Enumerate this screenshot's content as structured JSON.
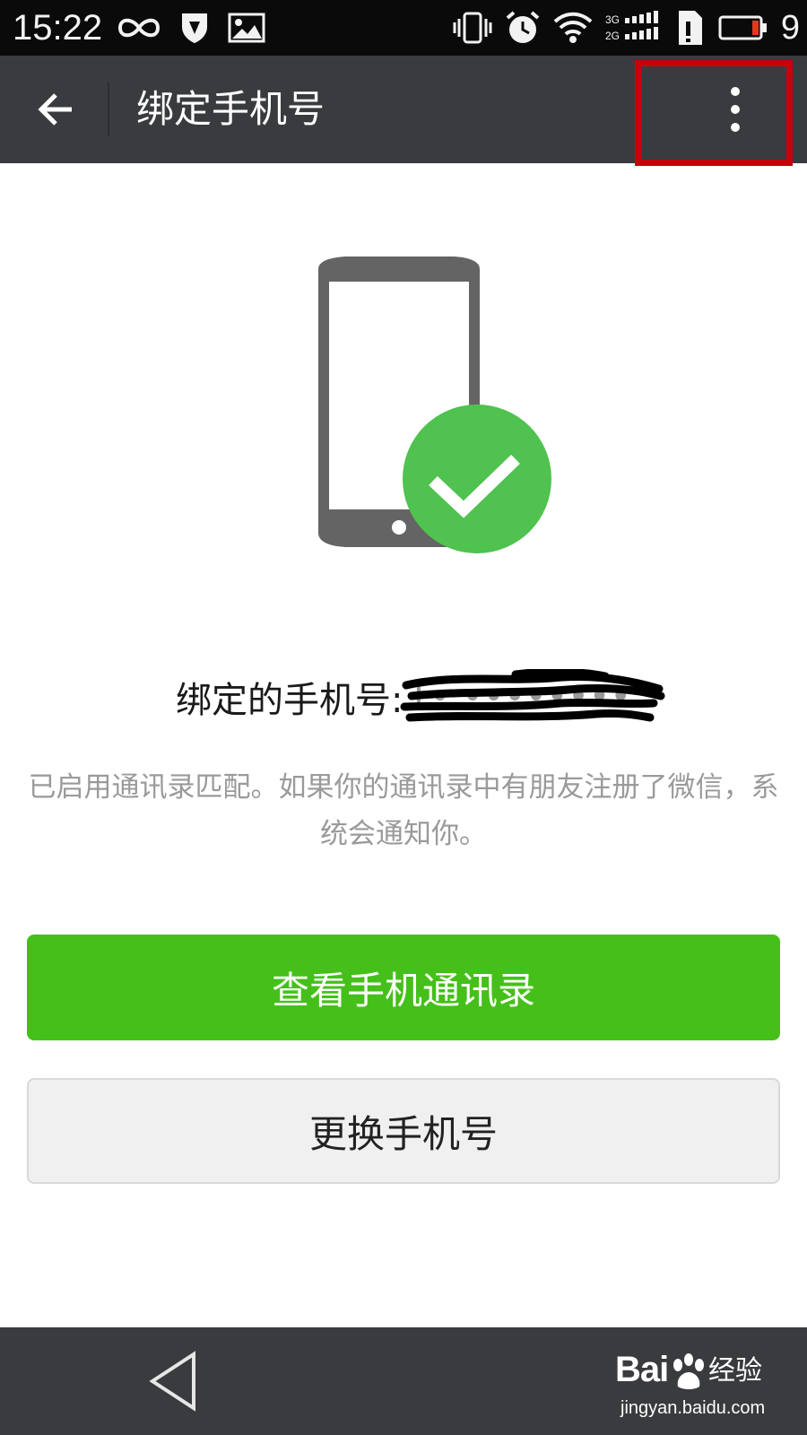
{
  "status_bar": {
    "time": "15:22",
    "battery_level": "9"
  },
  "header": {
    "title": "绑定手机号"
  },
  "main": {
    "phone_label": "绑定的手机号:",
    "phone_value": "1• ••••••••",
    "description": "已启用通讯录匹配。如果你的通讯录中有朋友注册了微信，系统会通知你。",
    "primary_button_label": "查看手机通讯录",
    "secondary_button_label": "更换手机号"
  },
  "watermark": {
    "brand": "Bai",
    "brand_suffix": "经验",
    "url": "jingyan.baidu.com"
  },
  "colors": {
    "accent_green": "#45c01a",
    "check_green": "#4fc24f",
    "highlight_red": "#c8000a",
    "bar_dark": "#3a3b3f"
  }
}
